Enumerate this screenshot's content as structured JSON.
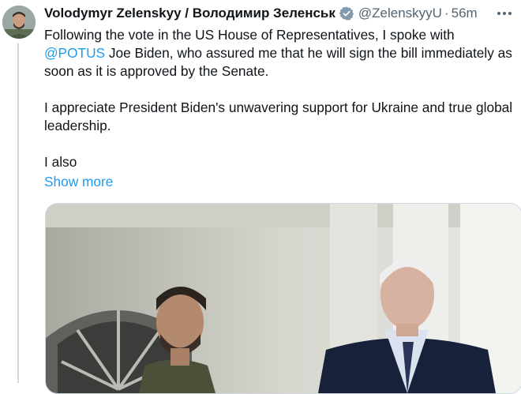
{
  "author": {
    "name": "Volodymyr Zelenskyy / Володимир Зеленськ",
    "handle": "@ZelenskyyU",
    "time": "56m",
    "verified": true
  },
  "tweet": {
    "line1": "Following the vote in the US House of Representatives, I spoke with",
    "mention": "@POTUS",
    "line2_rest": " Joe Biden, who assured me that he will sign the bill immediately as soon as it is approved by the Senate.",
    "para2": "I appreciate President Biden's unwavering support for Ukraine and true global leadership.",
    "para3": "I also",
    "show_more": "Show more"
  },
  "icons": {
    "verified": "verified-badge-icon",
    "more": "more-options-icon"
  },
  "colors": {
    "link": "#1d9bf0",
    "secondary_text": "#536471",
    "primary_text": "#0f1419"
  }
}
